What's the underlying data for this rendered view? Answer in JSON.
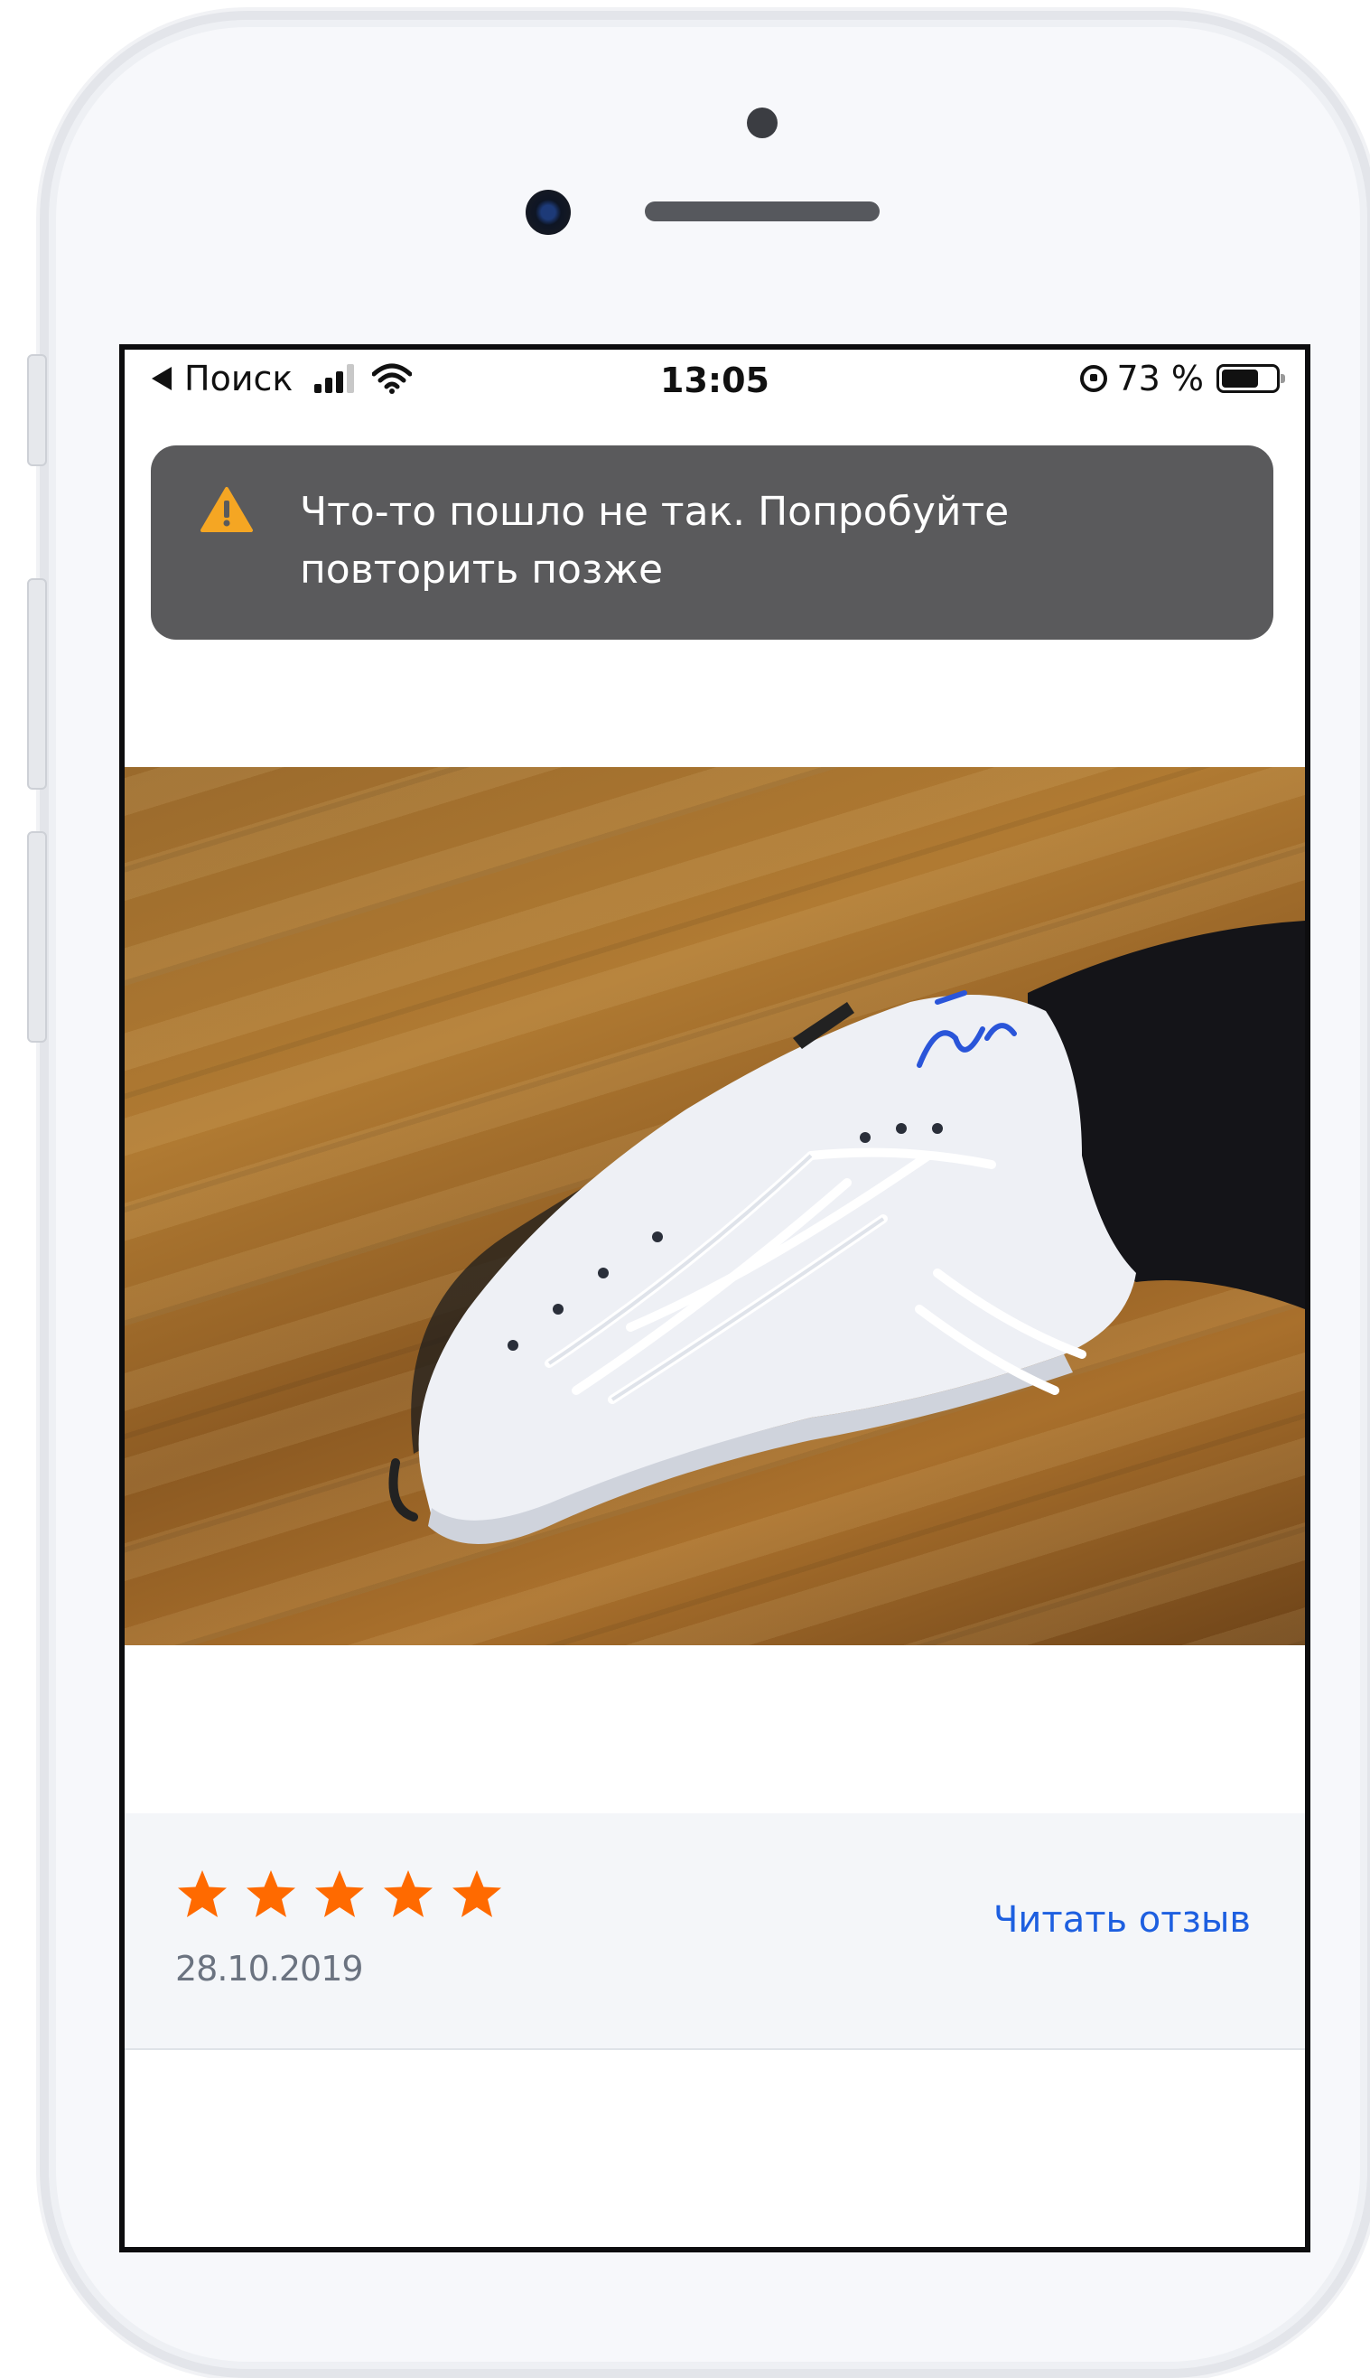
{
  "status_bar": {
    "back_label": "Поиск",
    "time": "13:05",
    "battery_percent": "73 %",
    "battery_level": 0.73
  },
  "toast": {
    "icon": "warning-icon",
    "message": "Что-то пошло не так. Попробуйте повторить позже",
    "icon_color": "#f5a623"
  },
  "photo": {
    "icon": "review-photo"
  },
  "review": {
    "rating": 5,
    "max_rating": 5,
    "date": "28.10.2019",
    "read_link": "Читать отзыв",
    "star_color": "#ff6a00",
    "link_color": "#1d5fe0"
  }
}
